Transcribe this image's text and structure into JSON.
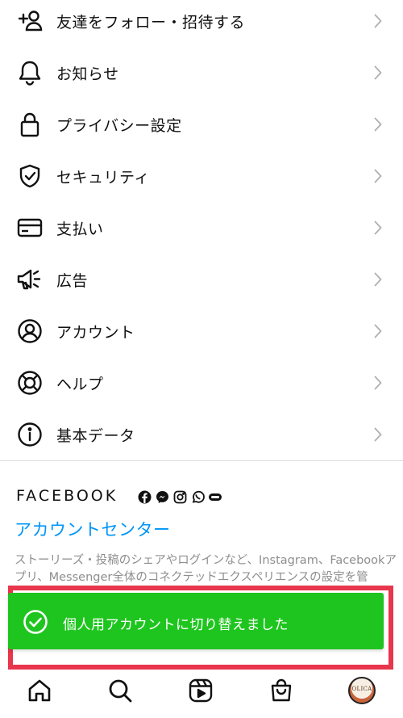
{
  "menu": {
    "items": [
      {
        "label": "友達をフォロー・招待する",
        "icon": "add-person-icon"
      },
      {
        "label": "お知らせ",
        "icon": "bell-icon"
      },
      {
        "label": "プライバシー設定",
        "icon": "lock-icon"
      },
      {
        "label": "セキュリティ",
        "icon": "shield-check-icon"
      },
      {
        "label": "支払い",
        "icon": "credit-card-icon"
      },
      {
        "label": "広告",
        "icon": "megaphone-icon"
      },
      {
        "label": "アカウント",
        "icon": "account-circle-icon"
      },
      {
        "label": "ヘルプ",
        "icon": "lifebuoy-icon"
      },
      {
        "label": "基本データ",
        "icon": "info-icon"
      }
    ]
  },
  "meta_section": {
    "brand": "FACEBOOK",
    "account_center_label": "アカウントセンター",
    "description": "ストーリーズ・投稿のシェアやログインなど、Instagram、Facebookアプリ、Messenger全体のコネクテッドエクスペリエンスの設定を管"
  },
  "toast": {
    "message": "個人用アカウントに切り替えました",
    "bg_color": "#1fc51f",
    "frame_color": "#e8364c"
  },
  "tabbar": {
    "avatar_text": "OLICA"
  },
  "colors": {
    "link": "#0095f6",
    "muted": "#8e8e8e"
  }
}
